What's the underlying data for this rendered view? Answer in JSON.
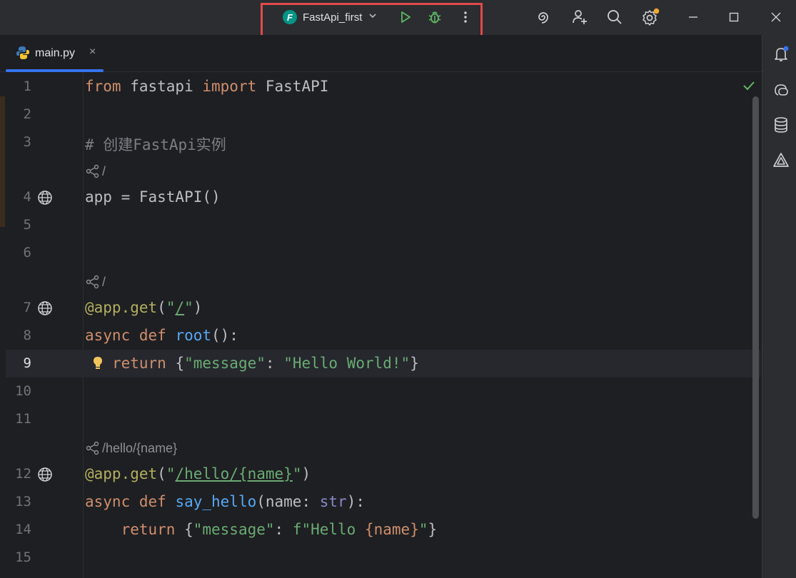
{
  "toolbar": {
    "run_config_name": "FastApi_first",
    "logo_letter": "F"
  },
  "tab": {
    "filename": "main.py",
    "close": "×"
  },
  "lines": [
    {
      "n": "1"
    },
    {
      "n": "2"
    },
    {
      "n": "3"
    },
    {
      "n": "4"
    },
    {
      "n": "5"
    },
    {
      "n": "6"
    },
    {
      "n": "7"
    },
    {
      "n": "8"
    },
    {
      "n": "9"
    },
    {
      "n": "10"
    },
    {
      "n": "11"
    },
    {
      "n": "12"
    },
    {
      "n": "13"
    },
    {
      "n": "14"
    },
    {
      "n": "15"
    }
  ],
  "code": {
    "l1_from": "from",
    "l1_mod": " fastapi ",
    "l1_import": "import",
    "l1_name": " FastAPI",
    "l3_comment": "# 创建FastApi实例",
    "endpoint1": "/",
    "l4": "app = FastAPI()",
    "endpoint2": "/",
    "l7_dec": "@app.get",
    "l7_open": "(",
    "l7_q1": "\"",
    "l7_path": "/",
    "l7_q2": "\"",
    "l7_close": ")",
    "l8_async": "async",
    "l8_def": " def ",
    "l8_fn": "root",
    "l8_rest": "():",
    "l9_return": "return",
    "l9_brace_open": " {",
    "l9_key": "\"message\"",
    "l9_colon": ": ",
    "l9_val": "\"Hello World!\"",
    "l9_brace_close": "}",
    "endpoint3": "/hello/{name}",
    "l12_dec": "@app.get",
    "l12_open": "(",
    "l12_q1": "\"",
    "l12_path": "/hello/{name}",
    "l12_q2": "\"",
    "l12_close": ")",
    "l13_async": "async",
    "l13_def": " def ",
    "l13_fn": "say_hello",
    "l13_p1": "(name: ",
    "l13_type": "str",
    "l13_p2": "):",
    "l14_return": "return",
    "l14_brace_open": " {",
    "l14_key": "\"message\"",
    "l14_colon": ": ",
    "l14_f": "f\"Hello ",
    "l14_interp": "{name}",
    "l14_end": "\"",
    "l14_brace_close": "}"
  },
  "colors": {
    "accent": "#3574f0",
    "highlight_border": "#e04a4a",
    "run_green": "#5fb865",
    "notification_dot": "#3574f0",
    "settings_dot": "#f0a732"
  }
}
